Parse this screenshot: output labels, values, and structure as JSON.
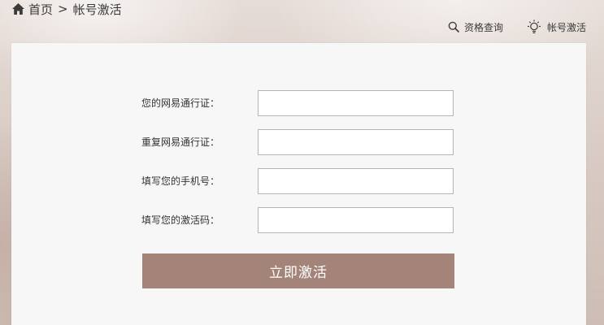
{
  "breadcrumb": {
    "home_label": "首页",
    "separator": ">",
    "current_label": "帐号激活"
  },
  "top_links": {
    "query_label": "资格查询",
    "activate_label": "帐号激活"
  },
  "form": {
    "fields": [
      {
        "label": "您的网易通行证：",
        "value": "",
        "placeholder": ""
      },
      {
        "label": "重复网易通行证：",
        "value": "",
        "placeholder": ""
      },
      {
        "label": "填写您的手机号：",
        "value": "",
        "placeholder": ""
      },
      {
        "label": "填写您的激活码：",
        "value": "",
        "placeholder": ""
      }
    ],
    "submit_label": "立即激活"
  },
  "colors": {
    "accent": "#a48379",
    "panel_bg": "#f7f7f7",
    "input_border": "#b5b5b5"
  },
  "icons": {
    "home": "home-icon",
    "search": "search-icon",
    "lightbulb": "lightbulb-icon"
  }
}
